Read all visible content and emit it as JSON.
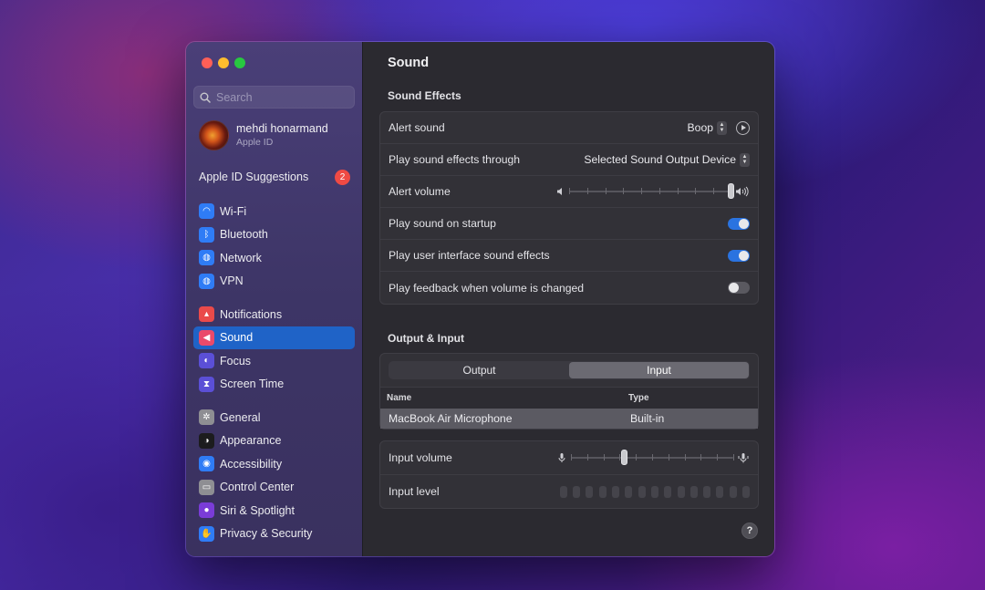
{
  "sidebar": {
    "search_placeholder": "Search",
    "profile": {
      "name": "mehdi honarmand",
      "subtitle": "Apple ID"
    },
    "suggestions": {
      "label": "Apple ID Suggestions",
      "badge": "2"
    },
    "groups": [
      [
        {
          "label": "Wi-Fi",
          "icon": "wifi-icon",
          "color": "#2f7cf6"
        },
        {
          "label": "Bluetooth",
          "icon": "bluetooth-icon",
          "color": "#2f7cf6"
        },
        {
          "label": "Network",
          "icon": "globe-icon",
          "color": "#2f7cf6"
        },
        {
          "label": "VPN",
          "icon": "vpn-globe-icon",
          "color": "#2f7cf6"
        }
      ],
      [
        {
          "label": "Notifications",
          "icon": "bell-icon",
          "color": "#ea4a4a"
        },
        {
          "label": "Sound",
          "icon": "speaker-icon",
          "color": "#ea4a6a",
          "active": true
        },
        {
          "label": "Focus",
          "icon": "moon-icon",
          "color": "#5b4fd6"
        },
        {
          "label": "Screen Time",
          "icon": "hourglass-icon",
          "color": "#5b4fd6"
        }
      ],
      [
        {
          "label": "General",
          "icon": "gear-icon",
          "color": "#8e8e93"
        },
        {
          "label": "Appearance",
          "icon": "appearance-icon",
          "color": "#1c1c1e"
        },
        {
          "label": "Accessibility",
          "icon": "accessibility-icon",
          "color": "#2f7cf6"
        },
        {
          "label": "Control Center",
          "icon": "control-center-icon",
          "color": "#8e8e93"
        },
        {
          "label": "Siri & Spotlight",
          "icon": "siri-icon",
          "color": "#7a3cd8"
        },
        {
          "label": "Privacy & Security",
          "icon": "hand-icon",
          "color": "#2f7cf6"
        }
      ]
    ]
  },
  "main": {
    "title": "Sound",
    "effects": {
      "heading": "Sound Effects",
      "alert_sound_label": "Alert sound",
      "alert_sound_value": "Boop",
      "play_through_label": "Play sound effects through",
      "play_through_value": "Selected Sound Output Device",
      "alert_volume_label": "Alert volume",
      "alert_volume_level": 1.0,
      "startup_label": "Play sound on startup",
      "startup_on": true,
      "ui_effects_label": "Play user interface sound effects",
      "ui_effects_on": true,
      "feedback_label": "Play feedback when volume is changed",
      "feedback_on": false
    },
    "io": {
      "heading": "Output & Input",
      "tab_output": "Output",
      "tab_input": "Input",
      "selected_tab": "Input",
      "col_name": "Name",
      "col_type": "Type",
      "devices": [
        {
          "name": "MacBook Air Microphone",
          "type": "Built-in"
        }
      ],
      "input_volume_label": "Input volume",
      "input_volume_level": 0.33,
      "input_level_label": "Input level",
      "input_level_segments": 15
    },
    "help_label": "?"
  }
}
